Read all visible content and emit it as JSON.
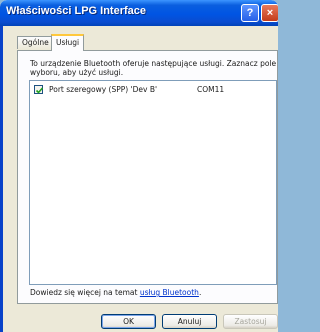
{
  "window": {
    "title": "Właściwości LPG Interface",
    "help_button": "?",
    "close_button": "×"
  },
  "tabs": [
    {
      "label": "Ogólne",
      "active": false
    },
    {
      "label": "Usługi",
      "active": true
    }
  ],
  "services": {
    "description": "To urządzenie Bluetooth oferuje następujące usługi. Zaznacz pole wyboru, aby użyć usługi.",
    "items": [
      {
        "name": "Port szeregowy (SPP) 'Dev B'",
        "port": "COM11",
        "checked": true
      }
    ]
  },
  "more_info": {
    "prefix": "Dowiedz się więcej na temat ",
    "link": "usług Bluetooth",
    "suffix": "."
  },
  "buttons": {
    "ok": "OK",
    "cancel": "Anuluj",
    "apply": "Zastosuj"
  },
  "colors": {
    "titlebar": "#0054e3",
    "dialog_bg": "#ece9d8",
    "tab_highlight": "#ffc83c",
    "link": "#0033cc"
  }
}
